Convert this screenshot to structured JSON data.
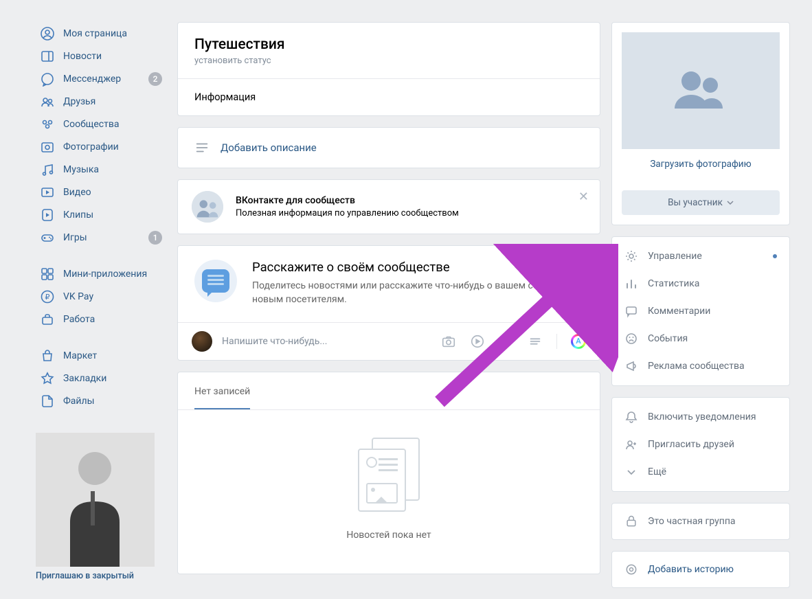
{
  "nav": {
    "items": [
      {
        "icon": "profile",
        "label": "Моя страница",
        "badge": null
      },
      {
        "icon": "news",
        "label": "Новости",
        "badge": null
      },
      {
        "icon": "messenger",
        "label": "Мессенджер",
        "badge": "2"
      },
      {
        "icon": "friends",
        "label": "Друзья",
        "badge": null
      },
      {
        "icon": "groups",
        "label": "Сообщества",
        "badge": null
      },
      {
        "icon": "photos",
        "label": "Фотографии",
        "badge": null
      },
      {
        "icon": "music",
        "label": "Музыка",
        "badge": null
      },
      {
        "icon": "video",
        "label": "Видео",
        "badge": null
      },
      {
        "icon": "clips",
        "label": "Клипы",
        "badge": null
      },
      {
        "icon": "games",
        "label": "Игры",
        "badge": "1"
      }
    ],
    "items2": [
      {
        "icon": "miniapps",
        "label": "Мини-приложения",
        "badge": null
      },
      {
        "icon": "vkpay",
        "label": "VK Pay",
        "badge": null
      },
      {
        "icon": "work",
        "label": "Работа",
        "badge": null
      }
    ],
    "items3": [
      {
        "icon": "market",
        "label": "Маркет",
        "badge": null
      },
      {
        "icon": "bookmarks",
        "label": "Закладки",
        "badge": null
      },
      {
        "icon": "files",
        "label": "Файлы",
        "badge": null
      }
    ]
  },
  "left_promo_text": "Приглашаю в закрытый",
  "group": {
    "title": "Путешествия",
    "status_placeholder": "установить статус",
    "info_label": "Информация",
    "add_desc_link": "Добавить описание"
  },
  "vk_groups_promo": {
    "title": "ВКонтакте для сообществ",
    "subtitle": "Полезная информация по управлению сообществом"
  },
  "tell": {
    "title": "Расскажите о своём сообществе",
    "subtitle": "Поделитесь новостями или расскажите что-нибудь о вашем сообществе новым посетителям."
  },
  "compose_placeholder": "Напишите что-нибудь...",
  "wall": {
    "tab_label": "Нет записей",
    "empty_text": "Новостей пока нет"
  },
  "right": {
    "upload_photo": "Загрузить фотографию",
    "member_button": "Вы участник",
    "menu": [
      {
        "label": "Управление",
        "icon": "gear",
        "dot": true
      },
      {
        "label": "Статистика",
        "icon": "stats",
        "dot": false
      },
      {
        "label": "Комментарии",
        "icon": "comment",
        "dot": false
      },
      {
        "label": "События",
        "icon": "event",
        "dot": false
      },
      {
        "label": "Реклама сообщества",
        "icon": "ads",
        "dot": false
      }
    ],
    "menu2": [
      {
        "label": "Включить уведомления",
        "icon": "bell"
      },
      {
        "label": "Пригласить друзей",
        "icon": "invite"
      },
      {
        "label": "Ещё",
        "icon": "more"
      }
    ],
    "private_text": "Это частная группа",
    "add_story": "Добавить историю"
  }
}
